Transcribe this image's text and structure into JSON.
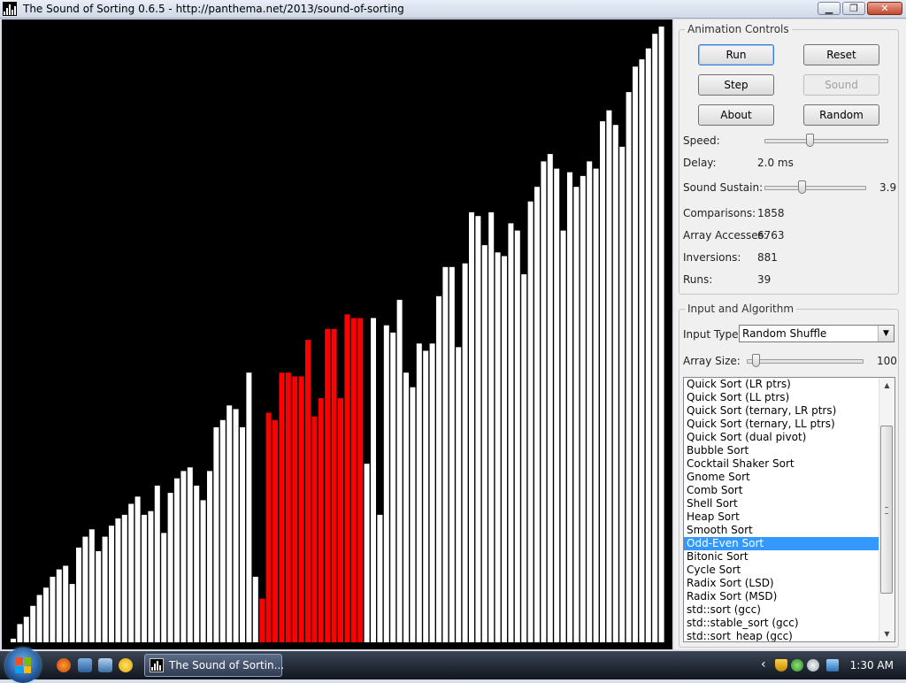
{
  "window": {
    "title": "The Sound of Sorting 0.6.5 - http://panthema.net/2013/sound-of-sorting",
    "minimize_glyph": "▁",
    "maximize_glyph": "❐",
    "close_glyph": "✕"
  },
  "visualization": {
    "colors": {
      "background": "#000000",
      "bar": "#ffffff",
      "highlight": "#ff0000"
    },
    "max_value": 100,
    "values": [
      1,
      5,
      7,
      10,
      13,
      15,
      18,
      20,
      21,
      16,
      26,
      29,
      31,
      25,
      29,
      32,
      34,
      35,
      38,
      40,
      35,
      36,
      43,
      30,
      41,
      45,
      47,
      48,
      43,
      39,
      47,
      59,
      61,
      65,
      64,
      59,
      74,
      18,
      12,
      63,
      61,
      74,
      74,
      73,
      73,
      83,
      62,
      67,
      86,
      86,
      67,
      90,
      89,
      89,
      49,
      89,
      35,
      87,
      85,
      94,
      74,
      70,
      82,
      80,
      82,
      95,
      103,
      103,
      81,
      104,
      118,
      117,
      109,
      118,
      107,
      106,
      115,
      113,
      101,
      121,
      125,
      132,
      134,
      130,
      113,
      129,
      125,
      128,
      132,
      130,
      143,
      146,
      142,
      136,
      151,
      158,
      160,
      163,
      167,
      169
    ],
    "highlighted_indices": [
      38,
      39,
      40,
      41,
      42,
      43,
      44,
      45,
      46,
      47,
      48,
      49,
      50,
      51,
      52,
      53
    ]
  },
  "animation_controls": {
    "title": "Animation Controls",
    "run_label": "Run",
    "reset_label": "Reset",
    "step_label": "Step",
    "sound_label": "Sound",
    "about_label": "About",
    "random_label": "Random",
    "speed_label": "Speed:",
    "speed_value": 0.36,
    "delay_label": "Delay:",
    "delay_value": "2.0 ms",
    "sustain_label": "Sound Sustain:",
    "sustain_value": "3.9",
    "sustain_fraction": 0.36
  },
  "stats": {
    "comparisons_label": "Comparisons:",
    "comparisons_value": "1858",
    "accesses_label": "Array Accesses:",
    "accesses_value": "6763",
    "inversions_label": "Inversions:",
    "inversions_value": "881",
    "runs_label": "Runs:",
    "runs_value": "39"
  },
  "input_algorithm": {
    "title": "Input and Algorithm",
    "input_type_label": "Input Type:",
    "input_type_value": "Random Shuffle",
    "array_size_label": "Array Size:",
    "array_size_value": "100",
    "array_size_fraction": 0.05,
    "algorithms": [
      "Quick Sort (LR ptrs)",
      "Quick Sort (LL ptrs)",
      "Quick Sort (ternary, LR ptrs)",
      "Quick Sort (ternary, LL ptrs)",
      "Quick Sort (dual pivot)",
      "Bubble Sort",
      "Cocktail Shaker Sort",
      "Gnome Sort",
      "Comb Sort",
      "Shell Sort",
      "Heap Sort",
      "Smooth Sort",
      "Odd-Even Sort",
      "Bitonic Sort",
      "Cycle Sort",
      "Radix Sort (LSD)",
      "Radix Sort (MSD)",
      "std::sort (gcc)",
      "std::stable_sort (gcc)",
      "std::sort_heap (gcc)"
    ],
    "selected_index": 12,
    "scroll_up_glyph": "▲",
    "scroll_down_glyph": "▼"
  },
  "taskbar": {
    "task_label": "The Sound of Sortin...",
    "clock": "1:30 AM",
    "tray_chevron": "‹"
  }
}
